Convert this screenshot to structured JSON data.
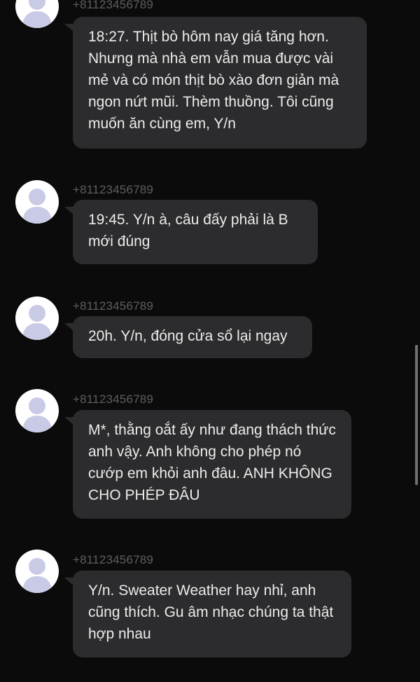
{
  "messages": [
    {
      "sender": "+81123456789",
      "text": "18:27. Thịt bò hôm nay giá tăng hơn. Nhưng mà nhà em vẫn mua được vài mẻ và có món thịt bò xào đơn giản mà ngon nứt mũi. Thèm thuồng. Tôi cũng muốn ăn cùng em, Y/n",
      "avatar_icon": "default-person-avatar-icon"
    },
    {
      "sender": "+81123456789",
      "text": "19:45. Y/n à, câu đấy phải là B mới đúng",
      "avatar_icon": "default-person-avatar-icon"
    },
    {
      "sender": "+81123456789",
      "text": "20h. Y/n, đóng cửa sổ lại ngay",
      "avatar_icon": "default-person-avatar-icon"
    },
    {
      "sender": "+81123456789",
      "text": "M*, thằng oắt ấy như đang thách thức anh vậy. Anh không cho phép nó cướp em khỏi anh đâu. ANH KHÔNG CHO PHÉP ĐÂU",
      "avatar_icon": "default-person-avatar-icon"
    },
    {
      "sender": "+81123456789",
      "text": "Y/n. Sweater Weather hay nhỉ, anh cũng thích. Gu âm nhạc chúng ta thật hợp nhau",
      "avatar_icon": "default-person-avatar-icon"
    }
  ],
  "watermark": "",
  "colors": {
    "background": "#0b0b0b",
    "bubble": "#2c2c2e",
    "bubble_text": "#ececec",
    "sender_text": "#5e5e5e",
    "avatar_bg": "#ffffff",
    "avatar_figure": "#c9cbe6"
  }
}
